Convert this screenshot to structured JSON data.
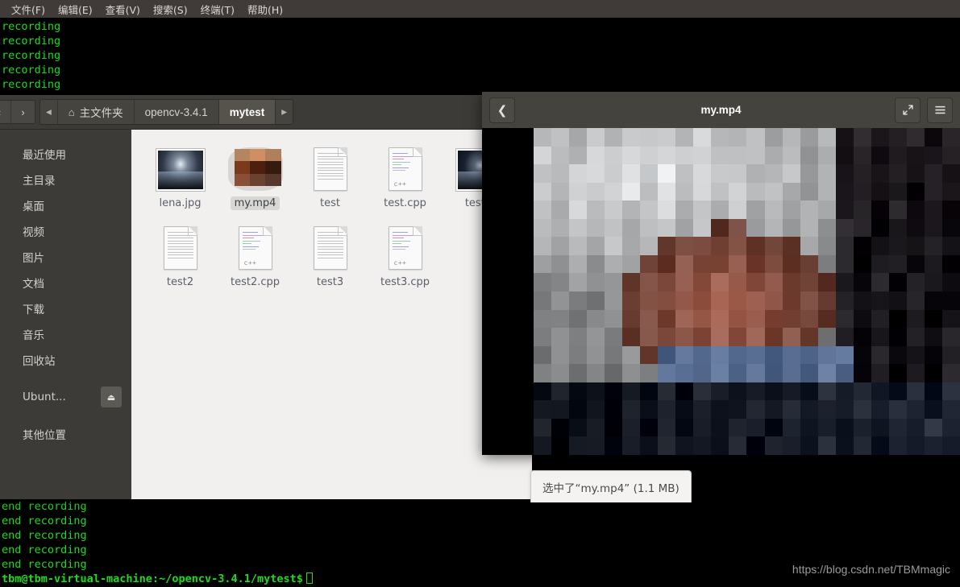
{
  "terminal": {
    "menu_items": [
      {
        "label": "文件(F)",
        "name": "menu-file"
      },
      {
        "label": "编辑(E)",
        "name": "menu-edit"
      },
      {
        "label": "查看(V)",
        "name": "menu-view"
      },
      {
        "label": "搜索(S)",
        "name": "menu-search"
      },
      {
        "label": "终端(T)",
        "name": "menu-terminal"
      },
      {
        "label": "帮助(H)",
        "name": "menu-help"
      }
    ],
    "top_lines": [
      "recording",
      "recording",
      "recording",
      "recording",
      "recording"
    ],
    "bottom_lines": [
      "end recording",
      "end recording",
      "end recording",
      "end recording",
      "end recording"
    ],
    "prompt": "tbm@tbm-virtual-machine:~/opencv-3.4.1/mytest$",
    "text_color": "#1cdc1c",
    "background": "#000000"
  },
  "watermark": {
    "text": "https://blog.csdn.net/TBMmagic"
  },
  "filemanager": {
    "nav": {
      "back_label": "‹",
      "forward_label": "›"
    },
    "breadcrumbs": [
      {
        "label": "◂",
        "name": "breadcrumb-scroll-left",
        "kind": "arrow"
      },
      {
        "label": "主文件夹",
        "name": "breadcrumb-home",
        "kind": "home"
      },
      {
        "label": "opencv-3.4.1",
        "name": "breadcrumb-opencv",
        "kind": "path"
      },
      {
        "label": "mytest",
        "name": "breadcrumb-mytest",
        "kind": "active"
      },
      {
        "label": "▸",
        "name": "breadcrumb-scroll-right",
        "kind": "arrow"
      }
    ],
    "sidebar": {
      "items": [
        {
          "label": "最近使用",
          "name": "sidebar-item-recent"
        },
        {
          "label": "主目录",
          "name": "sidebar-item-home"
        },
        {
          "label": "桌面",
          "name": "sidebar-item-desktop"
        },
        {
          "label": "视频",
          "name": "sidebar-item-videos"
        },
        {
          "label": "图片",
          "name": "sidebar-item-pictures"
        },
        {
          "label": "文档",
          "name": "sidebar-item-documents"
        },
        {
          "label": "下载",
          "name": "sidebar-item-downloads"
        },
        {
          "label": "音乐",
          "name": "sidebar-item-music"
        },
        {
          "label": "回收站",
          "name": "sidebar-item-trash"
        }
      ],
      "device": {
        "label": "Ubunt...",
        "name": "sidebar-item-ubuntu-disk",
        "eject_icon": "eject-icon"
      },
      "other": {
        "label": "其他位置",
        "name": "sidebar-item-other-locations"
      }
    },
    "files": [
      {
        "label": "lena.jpg",
        "type": "image",
        "selected": false
      },
      {
        "label": "my.mp4",
        "type": "video",
        "selected": true
      },
      {
        "label": "test",
        "type": "document",
        "selected": false
      },
      {
        "label": "test.cpp",
        "type": "cpp",
        "selected": false
      },
      {
        "label": "test.p",
        "type": "image-dark",
        "selected": false
      },
      {
        "label": "test2",
        "type": "document",
        "selected": false
      },
      {
        "label": "test2.cpp",
        "type": "cpp",
        "selected": false
      },
      {
        "label": "test3",
        "type": "document",
        "selected": false
      },
      {
        "label": "test3.cpp",
        "type": "cpp",
        "selected": false
      }
    ],
    "cpp_badge": "c++",
    "status": "选中了“my.mp4” (1.1 MB)"
  },
  "videoplayer": {
    "title": "my.mp4",
    "back_icon": "chevron-left-icon",
    "fullscreen_icon": "fullscreen-icon",
    "menu_icon": "hamburger-menu-icon"
  },
  "colors": {
    "terminal_green": "#1cdc1c",
    "header_dark": "#3c3b37",
    "window_chrome": "#45433e",
    "content_bg": "#f1f0ee",
    "label_text": "#5b5f6b"
  }
}
